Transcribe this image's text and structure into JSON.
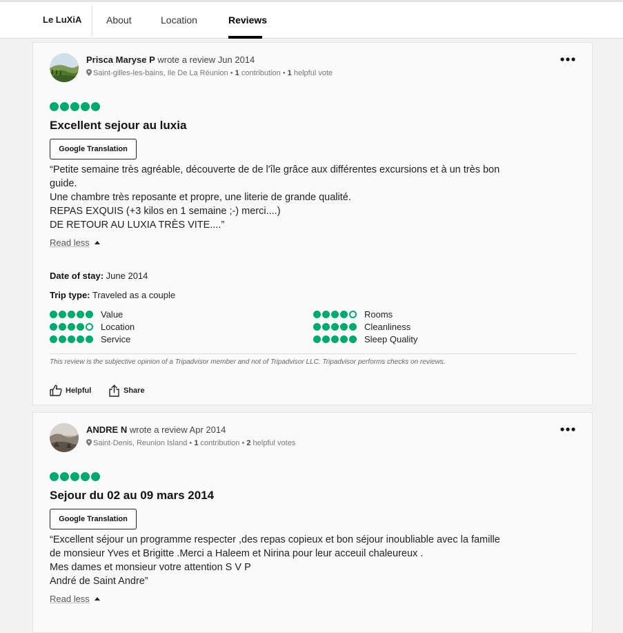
{
  "nav": {
    "brand": "Le LuXiA",
    "tabs": [
      {
        "label": "About"
      },
      {
        "label": "Location"
      },
      {
        "label": "Reviews"
      }
    ]
  },
  "theme": {
    "accent": "#00aa6c"
  },
  "reviews": [
    {
      "author": "Prisca Maryse P",
      "action": "wrote a review Jun 2014",
      "location": "Saint-gilles-les-bains, Ile De La Réunion",
      "contributions_count": "1",
      "contributions_label": "contribution",
      "helpful_count": "1",
      "helpful_label": "helpful vote",
      "rating": 5,
      "title": "Excellent sejour au luxia",
      "translate_label": "Google Translation",
      "body": [
        "“Petite semaine très agréable, découverte de de l'île grâce aux différentes excursions et à un très bon",
        "guide.",
        "Une chambre très reposante et propre, une literie de grande qualité.",
        "REPAS EXQUIS (+3 kilos en 1 semaine ;-) merci....)",
        "DE RETOUR AU LUXIA TRÈS VITE....”"
      ],
      "read_less": "Read less",
      "date_label": "Date of stay:",
      "date_value": "June 2014",
      "trip_label": "Trip type:",
      "trip_value": "Traveled as a couple",
      "subratings": [
        {
          "label": "Value",
          "value": 5
        },
        {
          "label": "Rooms",
          "value": 4
        },
        {
          "label": "Location",
          "value": 4
        },
        {
          "label": "Cleanliness",
          "value": 5
        },
        {
          "label": "Service",
          "value": 5
        },
        {
          "label": "Sleep Quality",
          "value": 5
        }
      ],
      "disclaimer": "This review is the subjective opinion of a Tripadvisor member and not of Tripadvisor LLC. Tripadvisor performs checks on reviews.",
      "helpful_btn": "Helpful",
      "share_btn": "Share"
    },
    {
      "author": "ANDRE N",
      "action": "wrote a review Apr 2014",
      "location": "Saint-Denis, Reunion Island",
      "contributions_count": "1",
      "contributions_label": "contribution",
      "helpful_count": "2",
      "helpful_label": "helpful votes",
      "rating": 5,
      "title": "Sejour du 02 au 09 mars 2014",
      "translate_label": "Google Translation",
      "body": [
        "“Excellent séjour un programme respecter ,des repas copieux et bon séjour inoubliable avec la famille",
        "de monsieur Yves et Brigitte .Merci a Haleem et Nirina pour leur acceuil chaleureux .",
        "Mes dames et monsieur votre attention S V P",
        "André de Saint Andre”"
      ],
      "read_less": "Read less"
    }
  ]
}
